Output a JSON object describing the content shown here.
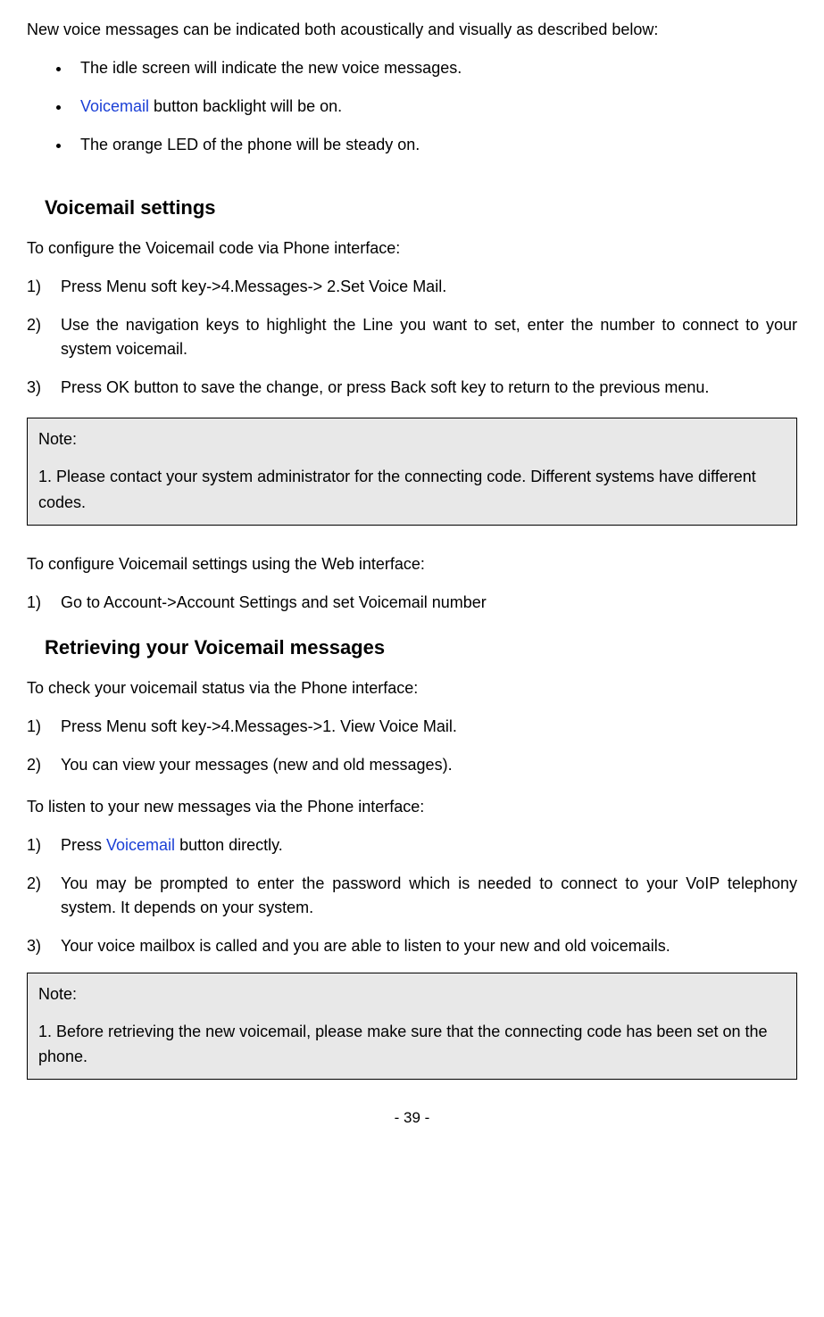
{
  "intro": "New voice messages can be indicated both acoustically and visually as described below:",
  "bullets": {
    "b1": "The idle screen will indicate the new voice messages.",
    "b2_pre": "Voicemail",
    "b2_post": " button backlight will be on.",
    "b3": "The orange LED of the phone will be steady on."
  },
  "section1": {
    "heading": "Voicemail settings",
    "intro": "To configure the Voicemail code via Phone interface:",
    "items": {
      "n1": "1)",
      "t1": "Press Menu soft key->4.Messages-> 2.Set Voice Mail.",
      "n2": "2)",
      "t2": "Use the navigation keys to highlight the Line you want to set, enter the number to connect to your system voicemail.",
      "n3": "3)",
      "t3": "Press OK button to save the change, or press Back soft key to return to the previous menu."
    }
  },
  "note1": {
    "label": "Note:",
    "body": "1. Please contact your system administrator for the connecting code. Different systems have different codes."
  },
  "web": {
    "intro": "To configure Voicemail settings using the Web interface:",
    "n1": "1)",
    "t1": "Go to   Account->Account Settings and set Voicemail number"
  },
  "section2": {
    "heading": "Retrieving your Voicemail messages",
    "introA": "To check your voicemail status via the Phone interface:",
    "a": {
      "n1": "1)",
      "t1": "Press Menu soft key->4.Messages->1. View Voice Mail.",
      "n2": "2)",
      "t2": "You can view your messages (new and old messages)."
    },
    "introB": "To listen to your new messages via the Phone interface:",
    "b": {
      "n1": "1)",
      "t1a": "Press ",
      "t1_term": "Voicemail",
      "t1b": " button directly.",
      "n2": "2)",
      "t2": "You may be prompted to enter the password which is needed to connect to your VoIP telephony system. It depends on your system.",
      "n3": "3)",
      "t3": "Your voice mailbox is called and you are able to listen to your new and old voicemails."
    }
  },
  "note2": {
    "label": "Note:",
    "body": "1. Before retrieving the new voicemail, please make sure that the connecting code has been set on the phone."
  },
  "pageNumber": "- 39 -"
}
